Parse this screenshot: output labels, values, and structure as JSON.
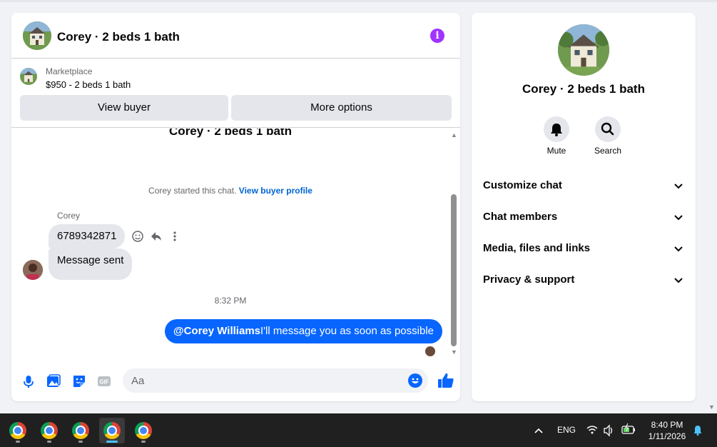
{
  "chat": {
    "title": "Corey · 2 beds 1 bath",
    "listing": {
      "source": "Marketplace",
      "price_line": "$950 - 2 beds 1 bath",
      "view_buyer_label": "View buyer",
      "more_options_label": "More options"
    },
    "thread_title": "Corey · 2 beds 1 bath",
    "started_text": "Corey started this chat.",
    "started_link": "View buyer profile",
    "sender_name": "Corey",
    "incoming_messages": [
      "6789342871",
      "Message sent"
    ],
    "timestamp": "8:32 PM",
    "outgoing_message": {
      "mention": "@Corey Williams",
      "text": "I'll message you as soon as possible"
    },
    "composer_placeholder": "Aa"
  },
  "info_panel": {
    "title": "Corey · 2 beds 1 bath",
    "mute_label": "Mute",
    "search_label": "Search",
    "sections": [
      "Customize chat",
      "Chat members",
      "Media, files and links",
      "Privacy & support"
    ]
  },
  "taskbar": {
    "apps": [
      "chrome-icon",
      "chrome-icon",
      "chrome-icon",
      "chrome-icon",
      "chrome-icon"
    ],
    "active_app": 3,
    "language": "ENG",
    "time": "8:40 PM",
    "date": "1/11/2026"
  },
  "colors": {
    "accent_blue": "#0866ff",
    "info_purple": "#a033ff",
    "bubble_gray": "#e4e6eb",
    "taskbar": "#202020"
  }
}
